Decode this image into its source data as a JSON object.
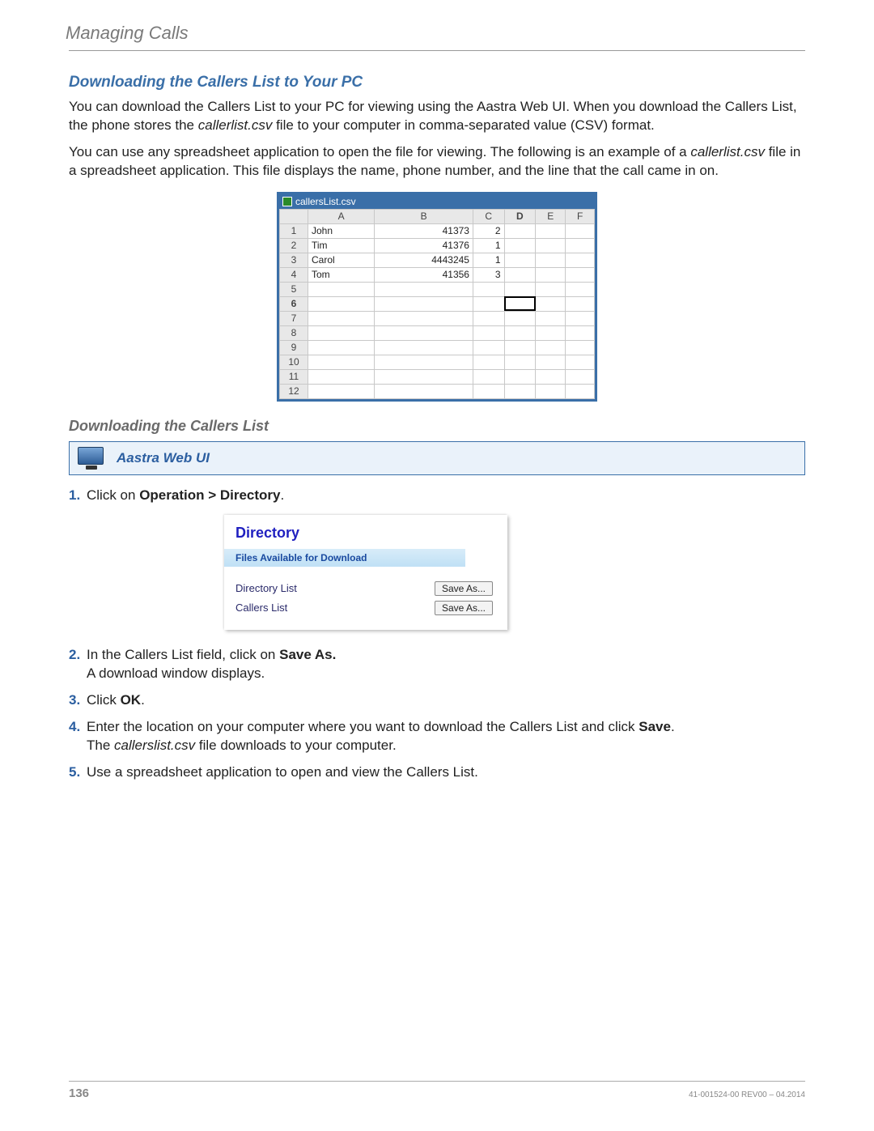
{
  "chapter": "Managing Calls",
  "section_title": "Downloading the Callers List to Your PC",
  "para1a": "You can download the Callers List to your PC for viewing using the Aastra Web UI. When you download the Callers List, the phone stores the ",
  "para1_file": "callerlist.csv",
  "para1b": " file to your computer in comma-separated value (CSV) format.",
  "para2a": "You can use any spreadsheet application to open the file for viewing. The following is an example of a ",
  "para2_file": "callerlist.csv",
  "para2b": " file in a spreadsheet application. This file displays the name, phone number, and the line that the call came in on.",
  "spreadsheet": {
    "filename": "callersList.csv",
    "cols": [
      "A",
      "B",
      "C",
      "D",
      "E",
      "F"
    ],
    "rows": [
      {
        "n": "1",
        "A": "John",
        "B": "41373",
        "C": "2"
      },
      {
        "n": "2",
        "A": "Tim",
        "B": "41376",
        "C": "1"
      },
      {
        "n": "3",
        "A": "Carol",
        "B": "4443245",
        "C": "1"
      },
      {
        "n": "4",
        "A": "Tom",
        "B": "41356",
        "C": "3"
      },
      {
        "n": "5"
      },
      {
        "n": "6"
      },
      {
        "n": "7"
      },
      {
        "n": "8"
      },
      {
        "n": "9"
      },
      {
        "n": "10"
      },
      {
        "n": "11"
      },
      {
        "n": "12"
      }
    ],
    "selected_row": "6",
    "selected_col": "D"
  },
  "subsection_title": "Downloading the Callers List",
  "callout_label": "Aastra Web UI",
  "steps": {
    "s1a": "Click on ",
    "s1b": "Operation > Directory",
    "s1c": ".",
    "s2a": "In the Callers List field, click on ",
    "s2b": "Save As.",
    "s2sub": "A download window displays.",
    "s3a": "Click ",
    "s3b": "OK",
    "s3c": ".",
    "s4a": "Enter the location on your computer where you want to download the Callers List and click ",
    "s4b": "Save",
    "s4c": ".",
    "s4sub_a": "The ",
    "s4sub_file": "callerslist.csv",
    "s4sub_b": " file downloads to your computer.",
    "s5": "Use a spreadsheet application to open and view the Callers List."
  },
  "directory_panel": {
    "title": "Directory",
    "subtitle": "Files Available for Download",
    "row1_label": "Directory List",
    "row2_label": "Callers List",
    "button": "Save As..."
  },
  "footer": {
    "page": "136",
    "docid": "41-001524-00 REV00 – 04.2014"
  }
}
